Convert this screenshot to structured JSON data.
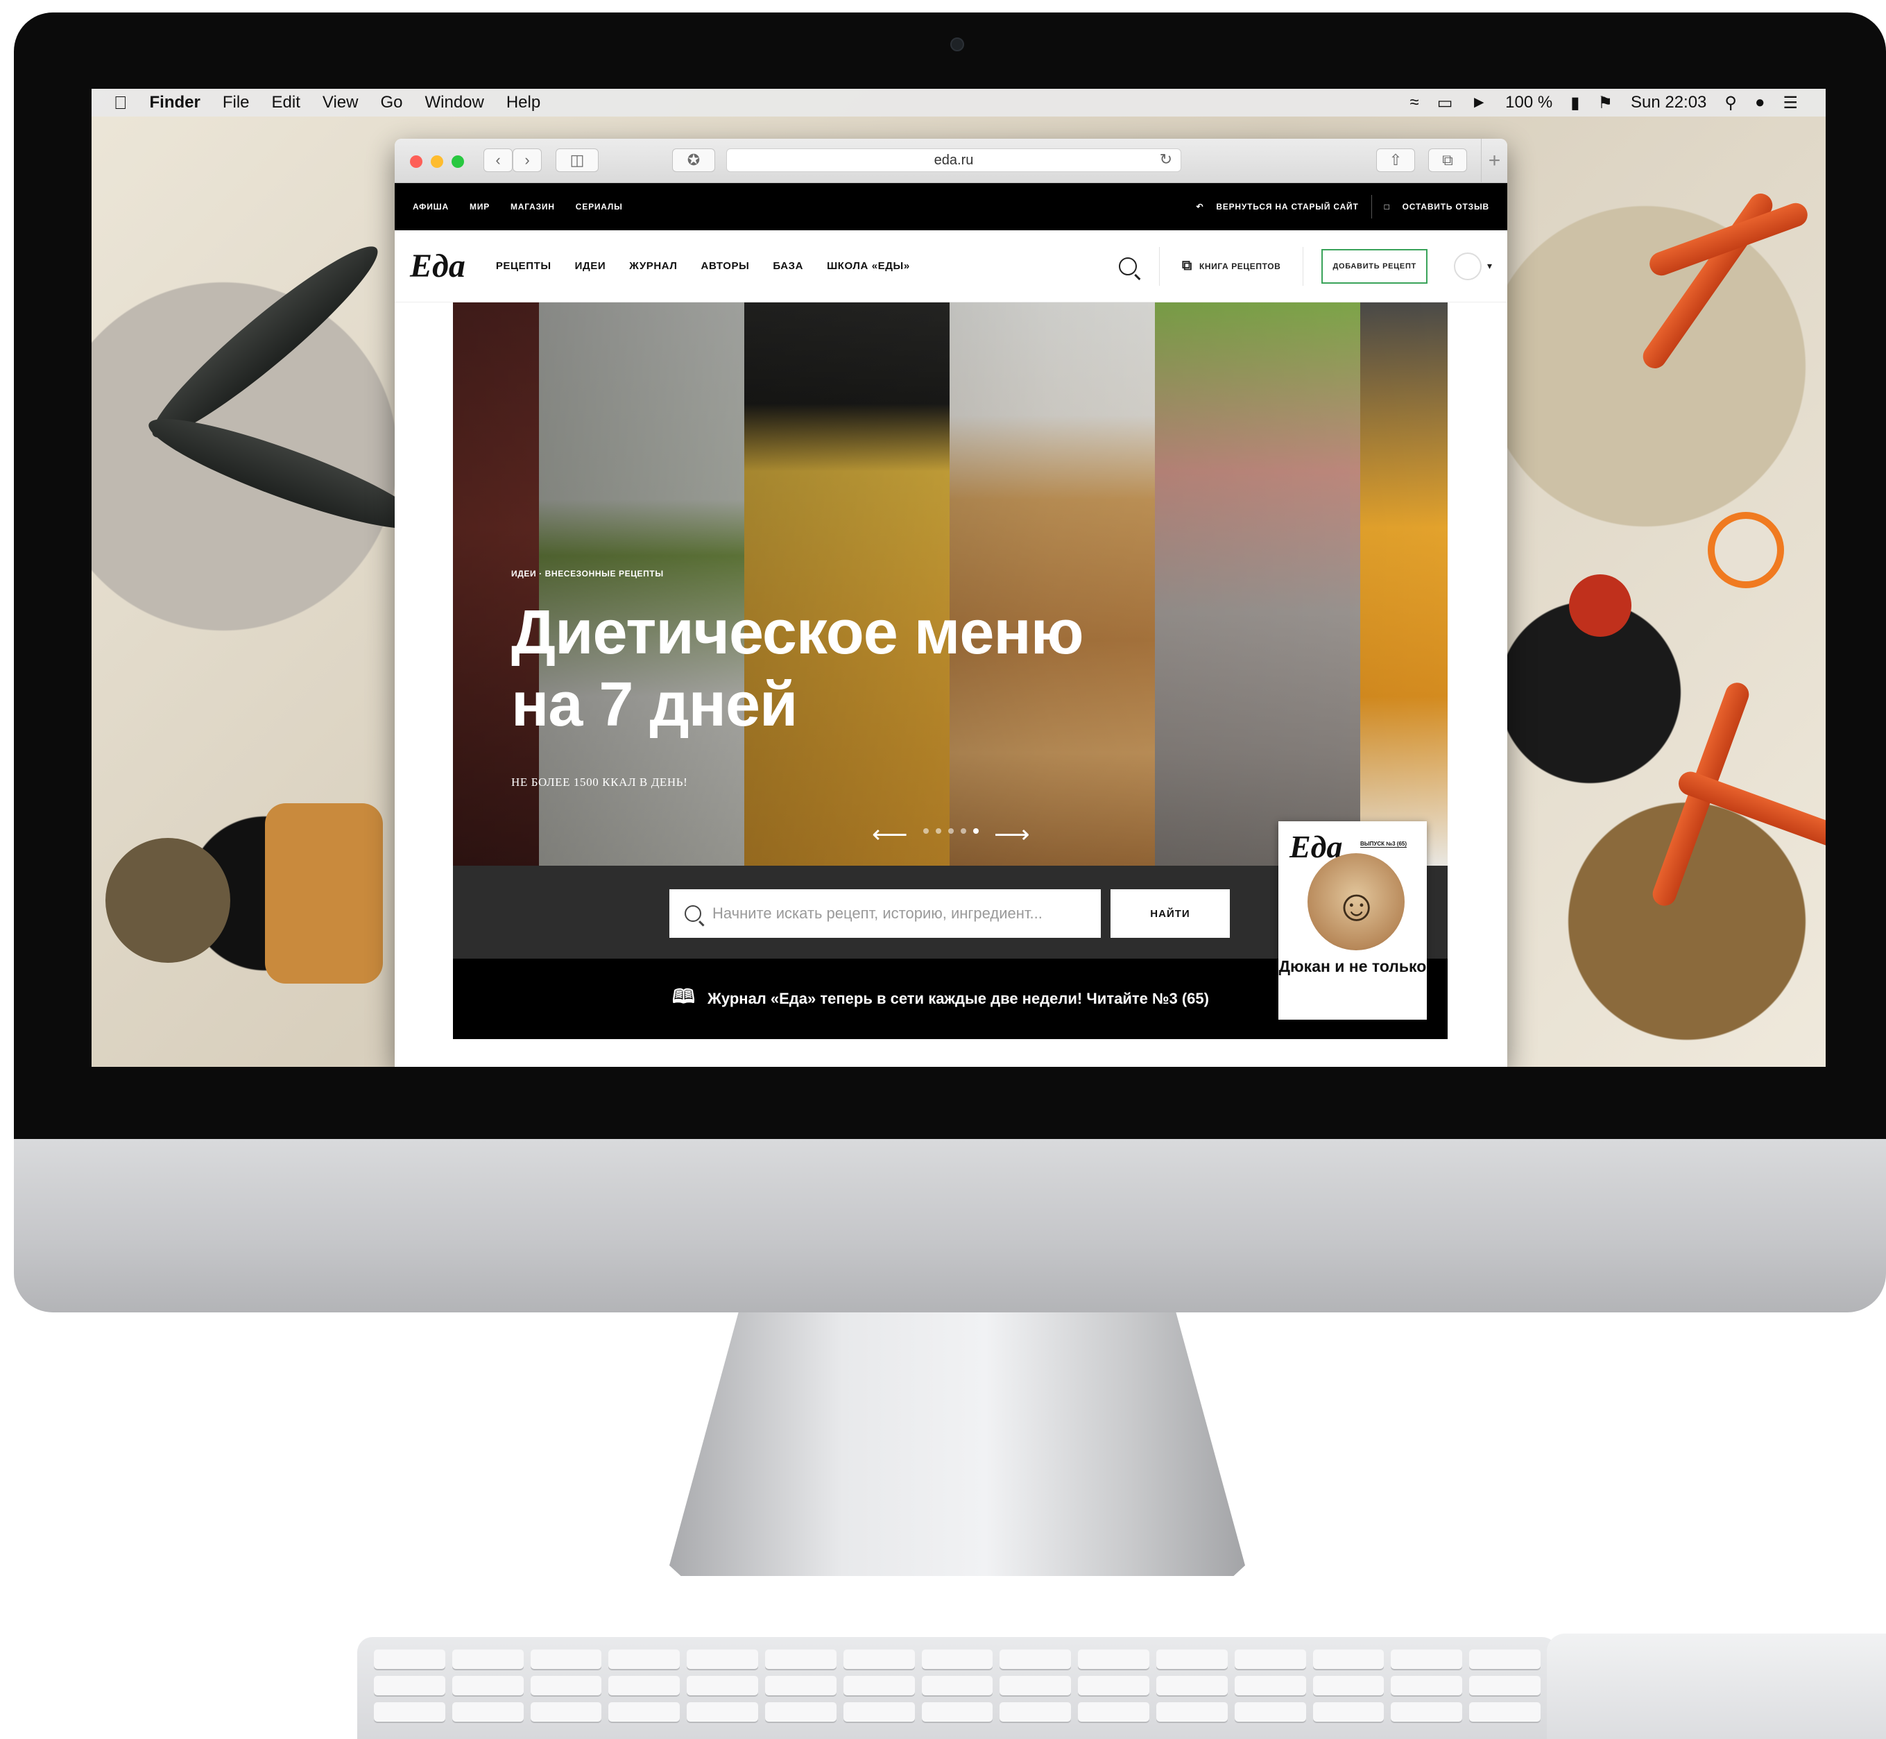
{
  "menubar": {
    "app": "Finder",
    "items": [
      "File",
      "Edit",
      "View",
      "Go",
      "Window",
      "Help"
    ],
    "battery": "100 %",
    "clock": "Sun 22:03"
  },
  "browser": {
    "url": "eda.ru"
  },
  "site": {
    "topnav": [
      "АФИША",
      "МИР",
      "МАГАЗИН",
      "СЕРИАЛЫ"
    ],
    "old_site": "ВЕРНУТЬСЯ НА СТАРЫЙ САЙТ",
    "feedback": "ОСТАВИТЬ ОТЗЫВ",
    "logo": "Еда",
    "nav": [
      "РЕЦЕПТЫ",
      "ИДЕИ",
      "ЖУРНАЛ",
      "АВТОРЫ",
      "БАЗА",
      "ШКОЛА «ЕДЫ»"
    ],
    "recipe_book": "КНИГА РЕЦЕПТОВ",
    "add_recipe": "ДОБАВИТЬ РЕЦЕПТ"
  },
  "hero": {
    "breadcrumb": "ИДЕИ · ВНЕСЕЗОННЫЕ РЕЦЕПТЫ",
    "title": "Диетическое меню на 7 дней",
    "subtitle": "НЕ БОЛЕЕ 1500 ККАЛ В ДЕНЬ!",
    "slides": 5,
    "active_slide": 5
  },
  "search": {
    "placeholder": "Начните искать рецепт, историю, ингредиент...",
    "button": "НАЙТИ"
  },
  "promo": {
    "text": "Журнал «Еда» теперь в сети каждые две недели! Читайте №3 (65)"
  },
  "magazine": {
    "logo": "Еда",
    "issue": "ВЫПУСК №3 (65)",
    "headline": "Дюкан и не только"
  },
  "colors": {
    "accent_green": "#3aa35a",
    "topbar": "#000000"
  },
  "icons": [
    "apple-icon",
    "wifi-icon",
    "volume-icon",
    "battery-icon",
    "flag-icon",
    "spotlight-icon",
    "siri-icon",
    "list-icon",
    "back-icon",
    "forward-icon",
    "sidebar-icon",
    "share-icon",
    "tabs-icon",
    "reload-icon",
    "search-icon",
    "book-icon",
    "avatar-icon"
  ]
}
